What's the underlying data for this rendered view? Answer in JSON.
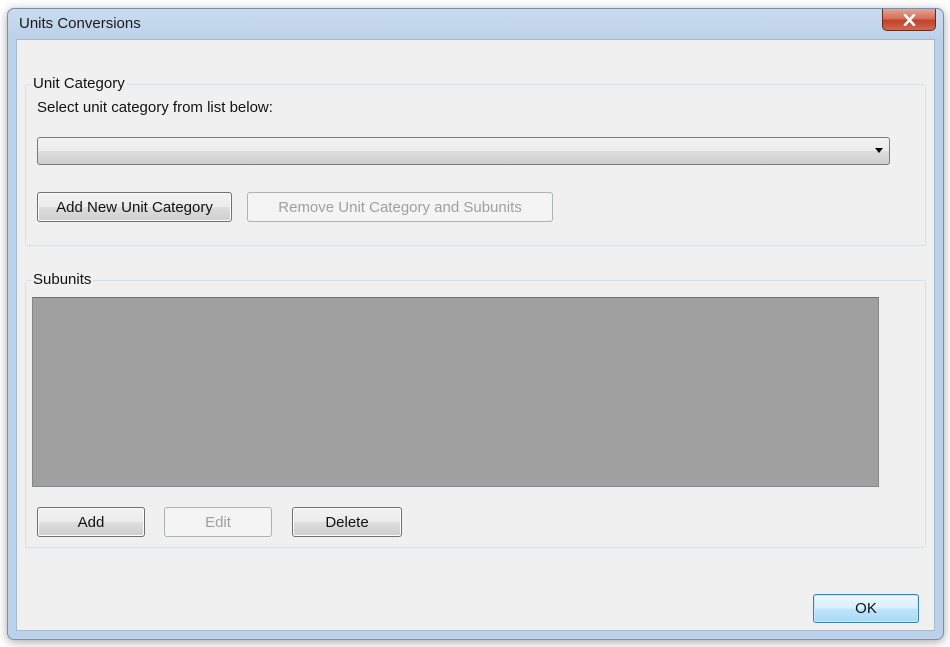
{
  "window": {
    "title": "Units Conversions"
  },
  "unit_category": {
    "group_label": "Unit Category",
    "instruction": "Select unit category from list below:",
    "combo_value": "",
    "add_button": "Add New Unit Category",
    "remove_button": "Remove Unit Category and Subunits"
  },
  "subunits": {
    "group_label": "Subunits",
    "items": [],
    "add_button": "Add",
    "edit_button": "Edit",
    "delete_button": "Delete"
  },
  "footer": {
    "ok_button": "OK"
  },
  "icons": {
    "close": "close-icon",
    "dropdown": "chevron-down-icon"
  },
  "colors": {
    "title_bar": "#bcd2ea",
    "close_button": "#c1412a",
    "client_bg": "#f0f0f0",
    "list_bg": "#a0a0a0",
    "default_button": "#a7d9f5"
  }
}
